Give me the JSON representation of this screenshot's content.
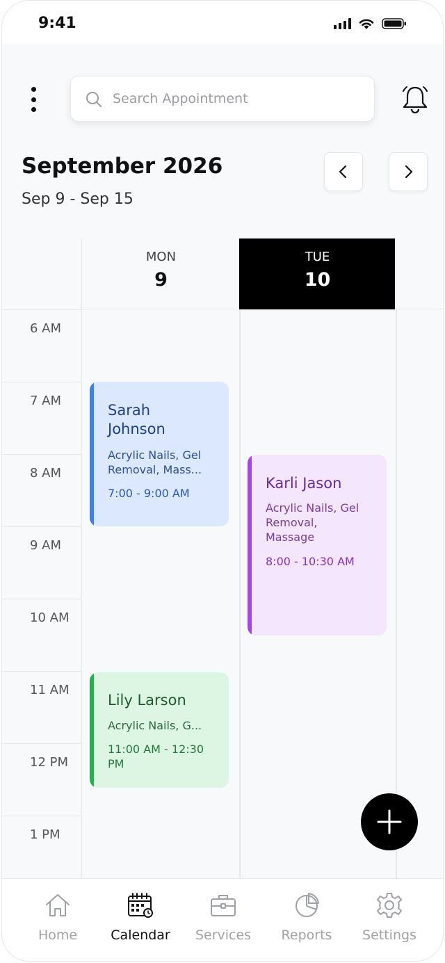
{
  "status_bar": {
    "time": "9:41"
  },
  "search": {
    "placeholder": "Search Appointment"
  },
  "calendar": {
    "month_title": "September 2026",
    "date_range": "Sep 9 - Sep 15",
    "days": [
      {
        "name": "MON",
        "number": "9",
        "selected": false
      },
      {
        "name": "TUE",
        "number": "10",
        "selected": true
      }
    ],
    "hours": [
      "6 AM",
      "7 AM",
      "8 AM",
      "9 AM",
      "10 AM",
      "11 AM",
      "12 PM",
      "1 PM"
    ],
    "appointments": [
      {
        "name_line1": "Sarah",
        "name_line2": "Johnson",
        "services_line1": "Acrylic Nails, Gel",
        "services_line2": "Removal, Mass...",
        "time": "7:00 - 9:00 AM",
        "day": "MON",
        "colors": {
          "bg": "#dbe8fd",
          "bar": "#3b7ff0",
          "text": "#1f3f8f"
        }
      },
      {
        "name": "Karli Jason",
        "services_line1": "Acrylic Nails, Gel",
        "services_line2": "Removal,",
        "services_line3": "Massage",
        "time": "8:00 - 10:30 AM",
        "day": "TUE",
        "colors": {
          "bg": "#f4e6fd",
          "bar": "#a347e8",
          "text": "#6a2a9a"
        }
      },
      {
        "name": "Lily Larson",
        "services": "Acrylic Nails, G...",
        "time_line1": "11:00 AM - 12:30",
        "time_line2": "PM",
        "day": "MON",
        "colors": {
          "bg": "#dcf6e3",
          "bar": "#22b24c",
          "text": "#1d5a2e"
        }
      }
    ]
  },
  "tab_bar": {
    "tabs": [
      {
        "label": "Home",
        "icon": "home-icon",
        "active": false
      },
      {
        "label": "Calendar",
        "icon": "calendar-icon",
        "active": true
      },
      {
        "label": "Services",
        "icon": "briefcase-icon",
        "active": false
      },
      {
        "label": "Reports",
        "icon": "pie-chart-icon",
        "active": false
      },
      {
        "label": "Settings",
        "icon": "gear-icon",
        "active": false
      }
    ]
  }
}
